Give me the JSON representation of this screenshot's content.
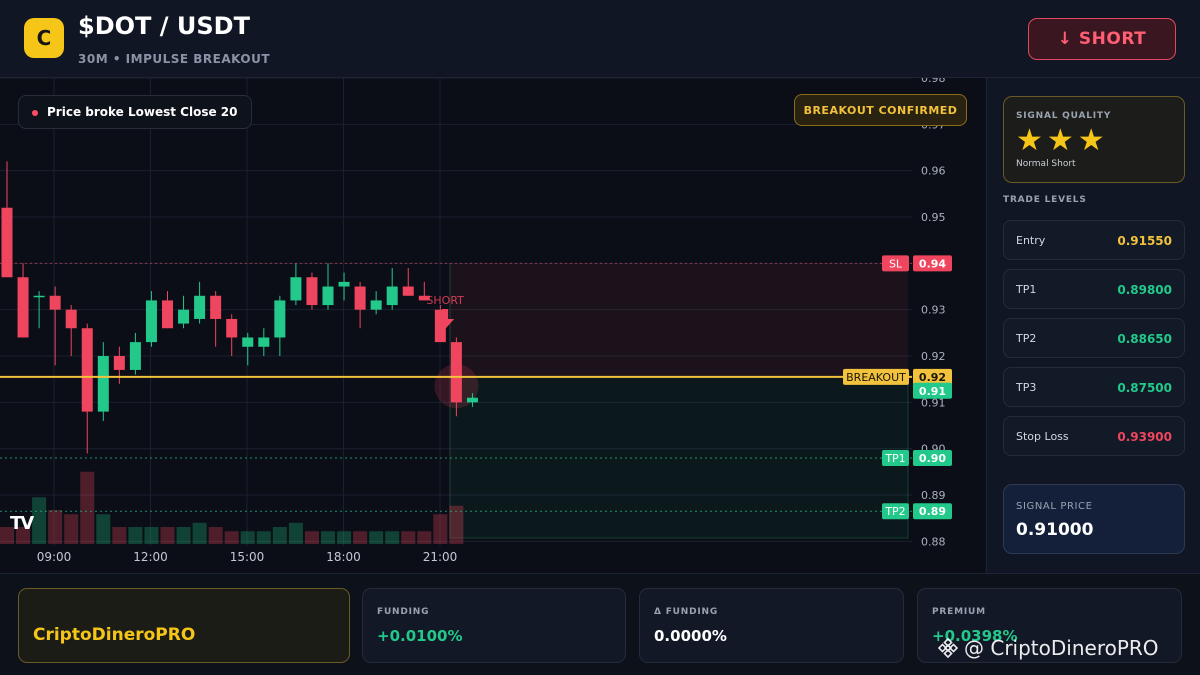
{
  "header": {
    "logo_letter": "C",
    "title": "$DOT / USDT",
    "subtitle": "30M • IMPULSE BREAKOUT",
    "action_label": "↓ SHORT"
  },
  "chart": {
    "info_pill": "Price broke Lowest Close 20",
    "confirm_badge": "BREAKOUT CONFIRMED",
    "short_marker": "SHORT",
    "tv_logo": "TV",
    "colors": {
      "up": "#22c98a",
      "down": "#f0455e",
      "breakout": "#f2c23c"
    }
  },
  "chart_data": {
    "type": "candlestick",
    "y_ticks": [
      "0.98",
      "0.97",
      "0.96",
      "0.95",
      "0.94",
      "0.93",
      "0.92",
      "0.91",
      "0.90",
      "0.89",
      "0.88"
    ],
    "y_values": [
      0.98,
      0.97,
      0.96,
      0.95,
      0.94,
      0.93,
      0.92,
      0.91,
      0.9,
      0.89,
      0.88
    ],
    "x_ticks": [
      "09:00",
      "12:00",
      "15:00",
      "18:00",
      "21:00"
    ],
    "ylim": [
      0.879,
      0.98
    ],
    "levels": [
      {
        "name": "SL",
        "value": 0.94,
        "label": "0.94",
        "color": "#f0455e"
      },
      {
        "name": "BREAKOUT",
        "value": 0.9155,
        "label": "0.92",
        "color": "#f2c23c"
      },
      {
        "name": "price",
        "value": 0.9125,
        "label": "0.91",
        "color": "#22c98a"
      },
      {
        "name": "TP1",
        "value": 0.898,
        "label": "0.90",
        "color": "#22c98a"
      },
      {
        "name": "TP2",
        "value": 0.8865,
        "label": "0.89",
        "color": "#22c98a"
      }
    ],
    "candles": [
      {
        "o": 0.952,
        "h": 0.962,
        "l": 0.948,
        "c": 0.937,
        "v": 0.2
      },
      {
        "o": 0.937,
        "h": 0.94,
        "l": 0.924,
        "c": 0.924,
        "v": 0.2
      },
      {
        "o": 0.933,
        "h": 0.934,
        "l": 0.926,
        "c": 0.933,
        "v": 0.55
      },
      {
        "o": 0.933,
        "h": 0.935,
        "l": 0.918,
        "c": 0.93,
        "v": 0.4
      },
      {
        "o": 0.93,
        "h": 0.931,
        "l": 0.92,
        "c": 0.926,
        "v": 0.35
      },
      {
        "o": 0.926,
        "h": 0.927,
        "l": 0.899,
        "c": 0.908,
        "v": 0.85
      },
      {
        "o": 0.908,
        "h": 0.923,
        "l": 0.906,
        "c": 0.92,
        "v": 0.35
      },
      {
        "o": 0.92,
        "h": 0.922,
        "l": 0.914,
        "c": 0.917,
        "v": 0.2
      },
      {
        "o": 0.917,
        "h": 0.925,
        "l": 0.916,
        "c": 0.923,
        "v": 0.2
      },
      {
        "o": 0.923,
        "h": 0.934,
        "l": 0.922,
        "c": 0.932,
        "v": 0.2
      },
      {
        "o": 0.932,
        "h": 0.934,
        "l": 0.926,
        "c": 0.926,
        "v": 0.2
      },
      {
        "o": 0.927,
        "h": 0.933,
        "l": 0.926,
        "c": 0.93,
        "v": 0.2
      },
      {
        "o": 0.928,
        "h": 0.936,
        "l": 0.927,
        "c": 0.933,
        "v": 0.25
      },
      {
        "o": 0.933,
        "h": 0.934,
        "l": 0.922,
        "c": 0.928,
        "v": 0.2
      },
      {
        "o": 0.928,
        "h": 0.929,
        "l": 0.92,
        "c": 0.924,
        "v": 0.15
      },
      {
        "o": 0.922,
        "h": 0.925,
        "l": 0.918,
        "c": 0.924,
        "v": 0.15
      },
      {
        "o": 0.922,
        "h": 0.926,
        "l": 0.92,
        "c": 0.924,
        "v": 0.15
      },
      {
        "o": 0.924,
        "h": 0.933,
        "l": 0.92,
        "c": 0.932,
        "v": 0.2
      },
      {
        "o": 0.932,
        "h": 0.94,
        "l": 0.931,
        "c": 0.937,
        "v": 0.25
      },
      {
        "o": 0.937,
        "h": 0.938,
        "l": 0.93,
        "c": 0.931,
        "v": 0.15
      },
      {
        "o": 0.931,
        "h": 0.94,
        "l": 0.93,
        "c": 0.935,
        "v": 0.15
      },
      {
        "o": 0.935,
        "h": 0.938,
        "l": 0.932,
        "c": 0.936,
        "v": 0.15
      },
      {
        "o": 0.935,
        "h": 0.936,
        "l": 0.926,
        "c": 0.93,
        "v": 0.15
      },
      {
        "o": 0.93,
        "h": 0.934,
        "l": 0.929,
        "c": 0.932,
        "v": 0.15
      },
      {
        "o": 0.931,
        "h": 0.939,
        "l": 0.93,
        "c": 0.935,
        "v": 0.15
      },
      {
        "o": 0.935,
        "h": 0.939,
        "l": 0.933,
        "c": 0.933,
        "v": 0.15
      },
      {
        "o": 0.933,
        "h": 0.936,
        "l": 0.932,
        "c": 0.932,
        "v": 0.15
      },
      {
        "o": 0.93,
        "h": 0.931,
        "l": 0.924,
        "c": 0.923,
        "v": 0.35
      },
      {
        "o": 0.923,
        "h": 0.924,
        "l": 0.907,
        "c": 0.91,
        "v": 0.45
      },
      {
        "o": 0.91,
        "h": 0.912,
        "l": 0.909,
        "c": 0.911,
        "v": 0.0
      }
    ]
  },
  "side": {
    "quality_label": "SIGNAL QUALITY",
    "stars": "★★★",
    "quality_desc": "Normal Short",
    "levels_title": "TRADE LEVELS",
    "levels": [
      {
        "label": "Entry",
        "value": "0.91550",
        "color": "#f2c23c"
      },
      {
        "label": "TP1",
        "value": "0.89800",
        "color": "#22c98a"
      },
      {
        "label": "TP2",
        "value": "0.88650",
        "color": "#22c98a"
      },
      {
        "label": "TP3",
        "value": "0.87500",
        "color": "#22c98a"
      },
      {
        "label": "Stop Loss",
        "value": "0.93900",
        "color": "#f0455e"
      }
    ],
    "signal_price_label": "SIGNAL PRICE",
    "signal_price": "0.91000"
  },
  "footer": {
    "brand": "CriptoDineroPRO",
    "stats": [
      {
        "label": "FUNDING",
        "value": "+0.0100%",
        "color": "#22c98a"
      },
      {
        "label": "Δ FUNDING",
        "value": "0.0000%",
        "color": "#ffffff"
      },
      {
        "label": "PREMIUM",
        "value": "+0.0398%",
        "color": "#22c98a"
      }
    ],
    "watermark": "@ CriptoDineroPRO"
  }
}
